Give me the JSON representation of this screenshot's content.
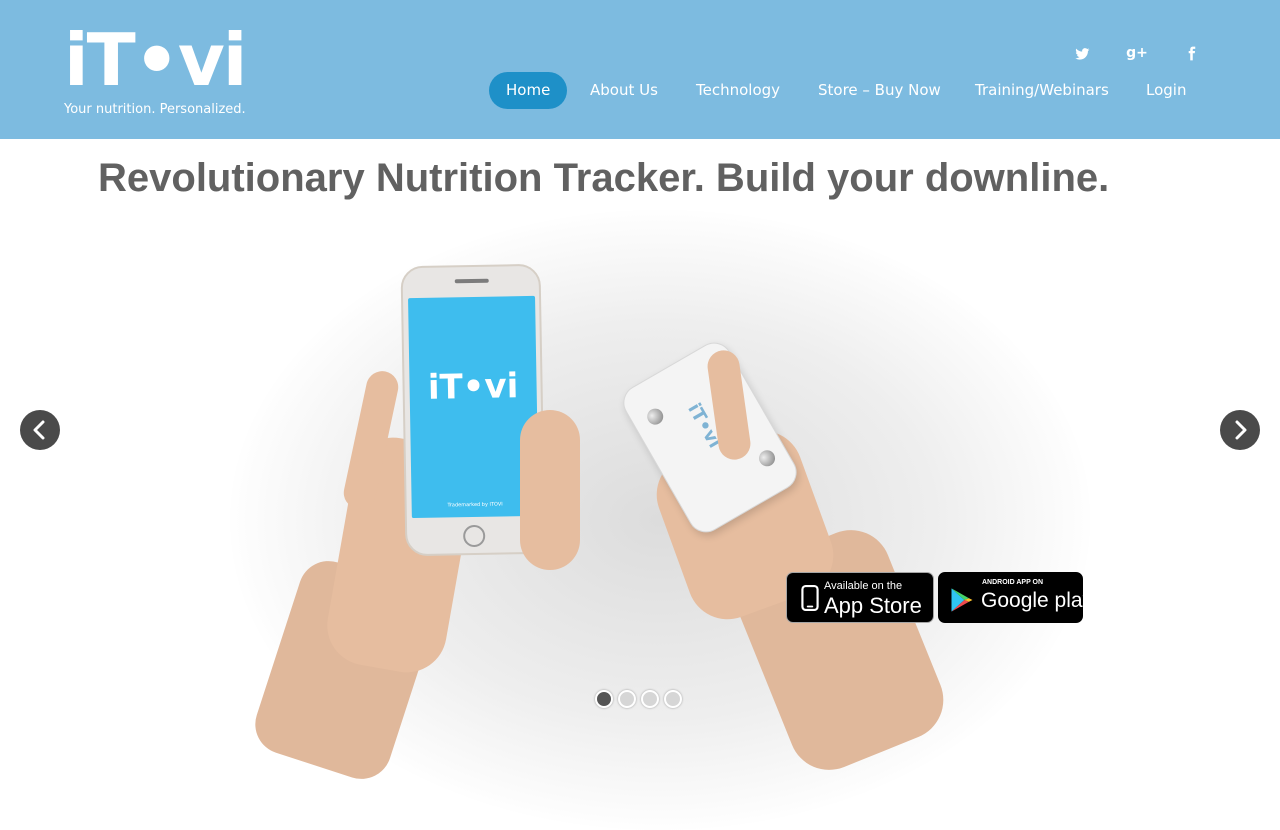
{
  "brand": {
    "logo_text": "iT•vi",
    "tagline": "Your nutrition. Personalized."
  },
  "social": {
    "twitter": "twitter-icon",
    "google_plus": "google-plus-icon",
    "google_plus_glyph": "g+",
    "facebook": "facebook-icon"
  },
  "nav": {
    "items": [
      {
        "label": "Home",
        "active": true
      },
      {
        "label": "About Us"
      },
      {
        "label": "Technology"
      },
      {
        "label": "Store – Buy Now"
      },
      {
        "label": "Training/Webinars"
      },
      {
        "label": "Login"
      }
    ]
  },
  "hero": {
    "headline": "Revolutionary Nutrition Tracker. Build your downline.",
    "phone_logo": "iT•vi",
    "phone_trademark": "Trademarked by ITOVI",
    "device_logo": "iT•vi"
  },
  "badges": {
    "apple_small": "Available on the",
    "apple_big": "App Store",
    "google_small": "ANDROID APP ON",
    "google_big": "Google play"
  },
  "carousel": {
    "slide_count": 4,
    "active_slide": 1
  },
  "colors": {
    "header_bg": "#7dbbe0",
    "nav_active": "#1e90c8",
    "phone_screen": "#3ebdee",
    "headline": "#616161"
  }
}
